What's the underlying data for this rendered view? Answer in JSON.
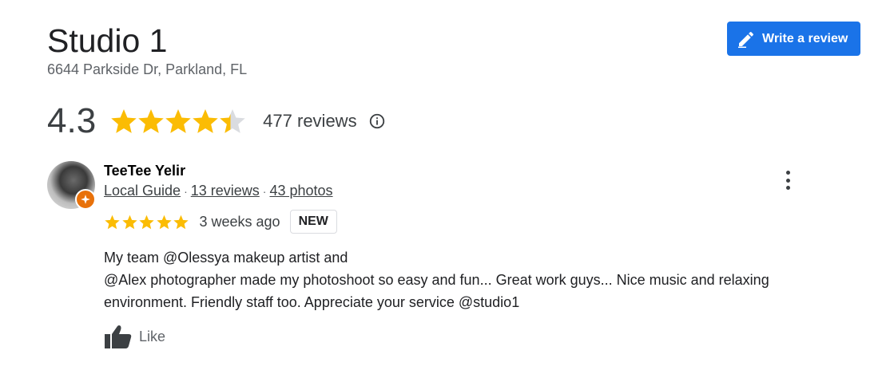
{
  "place": {
    "name": "Studio 1",
    "address": "6644 Parkside Dr, Parkland, FL"
  },
  "header": {
    "write_review_label": "Write a review",
    "write_review_icon": "pencil-icon"
  },
  "summary": {
    "rating": "4.3",
    "rating_value": 4.3,
    "rating_max": 5,
    "review_count_label": "477 reviews",
    "info_icon": "info-icon"
  },
  "colors": {
    "accent": "#1a73e8",
    "star": "#fbbc04",
    "star_empty": "#dadce0",
    "local_guide_badge": "#e8710a"
  },
  "review": {
    "reviewer_name": "TeeTee Yelir",
    "reviewer_level": "Local Guide",
    "reviewer_reviews": "13 reviews",
    "reviewer_photos": "43 photos",
    "separator": "·",
    "stars": 5,
    "date": "3 weeks ago",
    "badge": "NEW",
    "text_lines": [
      "My team @Olessya makeup artist and",
      "@Alex photographer made my photoshoot so easy and fun... Great work guys... Nice music and relaxing",
      "environment. Friendly staff too. Appreciate your service @studio1"
    ],
    "like_label": "Like",
    "more_icon": "more-vertical-icon"
  }
}
